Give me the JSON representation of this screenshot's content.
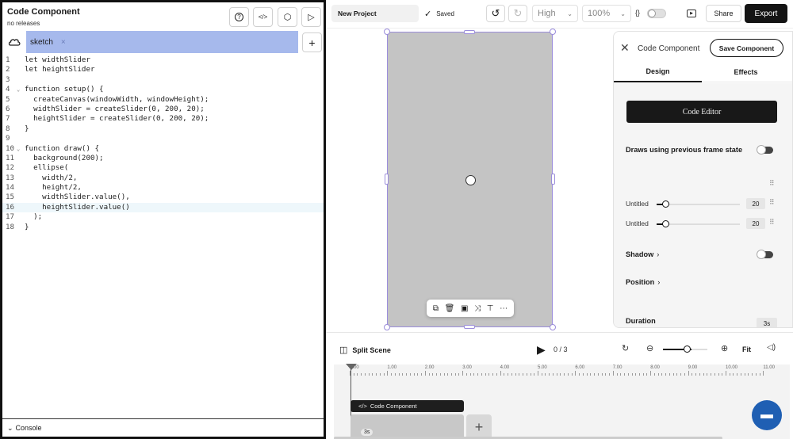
{
  "code_pane": {
    "title": "Code Component",
    "subtitle": "no releases",
    "tab_name": "sketch",
    "tab_close": "×",
    "add_tab": "+",
    "console_label": "Console",
    "lines": [
      {
        "n": "1",
        "fold": "",
        "code": "let widthSlider"
      },
      {
        "n": "2",
        "fold": "",
        "code": "let heightSlider"
      },
      {
        "n": "3",
        "fold": "",
        "code": ""
      },
      {
        "n": "4",
        "fold": "⌄",
        "code": "function setup() {"
      },
      {
        "n": "5",
        "fold": "",
        "code": "  createCanvas(windowWidth, windowHeight);"
      },
      {
        "n": "6",
        "fold": "",
        "code": "  widthSlider = createSlider(0, 200, 20);"
      },
      {
        "n": "7",
        "fold": "",
        "code": "  heightSlider = createSlider(0, 200, 20);"
      },
      {
        "n": "8",
        "fold": "",
        "code": "}"
      },
      {
        "n": "9",
        "fold": "",
        "code": ""
      },
      {
        "n": "10",
        "fold": "⌄",
        "code": "function draw() {"
      },
      {
        "n": "11",
        "fold": "",
        "code": "  background(200);"
      },
      {
        "n": "12",
        "fold": "",
        "code": "  ellipse("
      },
      {
        "n": "13",
        "fold": "",
        "code": "    width/2,"
      },
      {
        "n": "14",
        "fold": "",
        "code": "    height/2,"
      },
      {
        "n": "15",
        "fold": "",
        "code": "    widthSlider.value(),"
      },
      {
        "n": "16",
        "fold": "",
        "code": "    heightSlider.value()"
      },
      {
        "n": "17",
        "fold": "",
        "code": "  );"
      },
      {
        "n": "18",
        "fold": "",
        "code": "}"
      }
    ],
    "active_line": 16
  },
  "toolbar": {
    "project_name": "New Project",
    "saved_label": "Saved",
    "quality": "High",
    "zoom": "100%",
    "code_toggle_label": "{}",
    "share_label": "Share",
    "export_label": "Export"
  },
  "panel": {
    "title": "Code Component",
    "save_label": "Save Component",
    "tabs": [
      "Design",
      "Effects"
    ],
    "code_editor_label": "Code Editor",
    "draws_prev_label": "Draws using previous frame state",
    "sliders": [
      {
        "label": "Untitled",
        "value": "20",
        "fraction": 0.1
      },
      {
        "label": "Untitled",
        "value": "20",
        "fraction": 0.1
      }
    ],
    "shadow_label": "Shadow",
    "position_label": "Position",
    "duration_label": "Duration",
    "duration_value": "3s"
  },
  "timeline": {
    "split_scene_label": "Split Scene",
    "frame_count": "0 / 3",
    "fit_label": "Fit",
    "ruler_labels": [
      "0:00",
      "1.00",
      "2.00",
      "3.00",
      "4.00",
      "5.00",
      "6.00",
      "7.00",
      "8.00",
      "9.00",
      "10.00",
      "11.00"
    ],
    "clip_label": "Code Component",
    "scene_duration": "3s",
    "add_scene": "+"
  },
  "icons": {
    "help": "?",
    "code": "</>",
    "package": "⬡",
    "run": "▷",
    "undo": "↺",
    "redo": "↻",
    "preview": "▭",
    "play": "▶",
    "zoom_out": "⊖",
    "zoom_in": "⊕",
    "volume": "🔈",
    "chat": "💬"
  }
}
